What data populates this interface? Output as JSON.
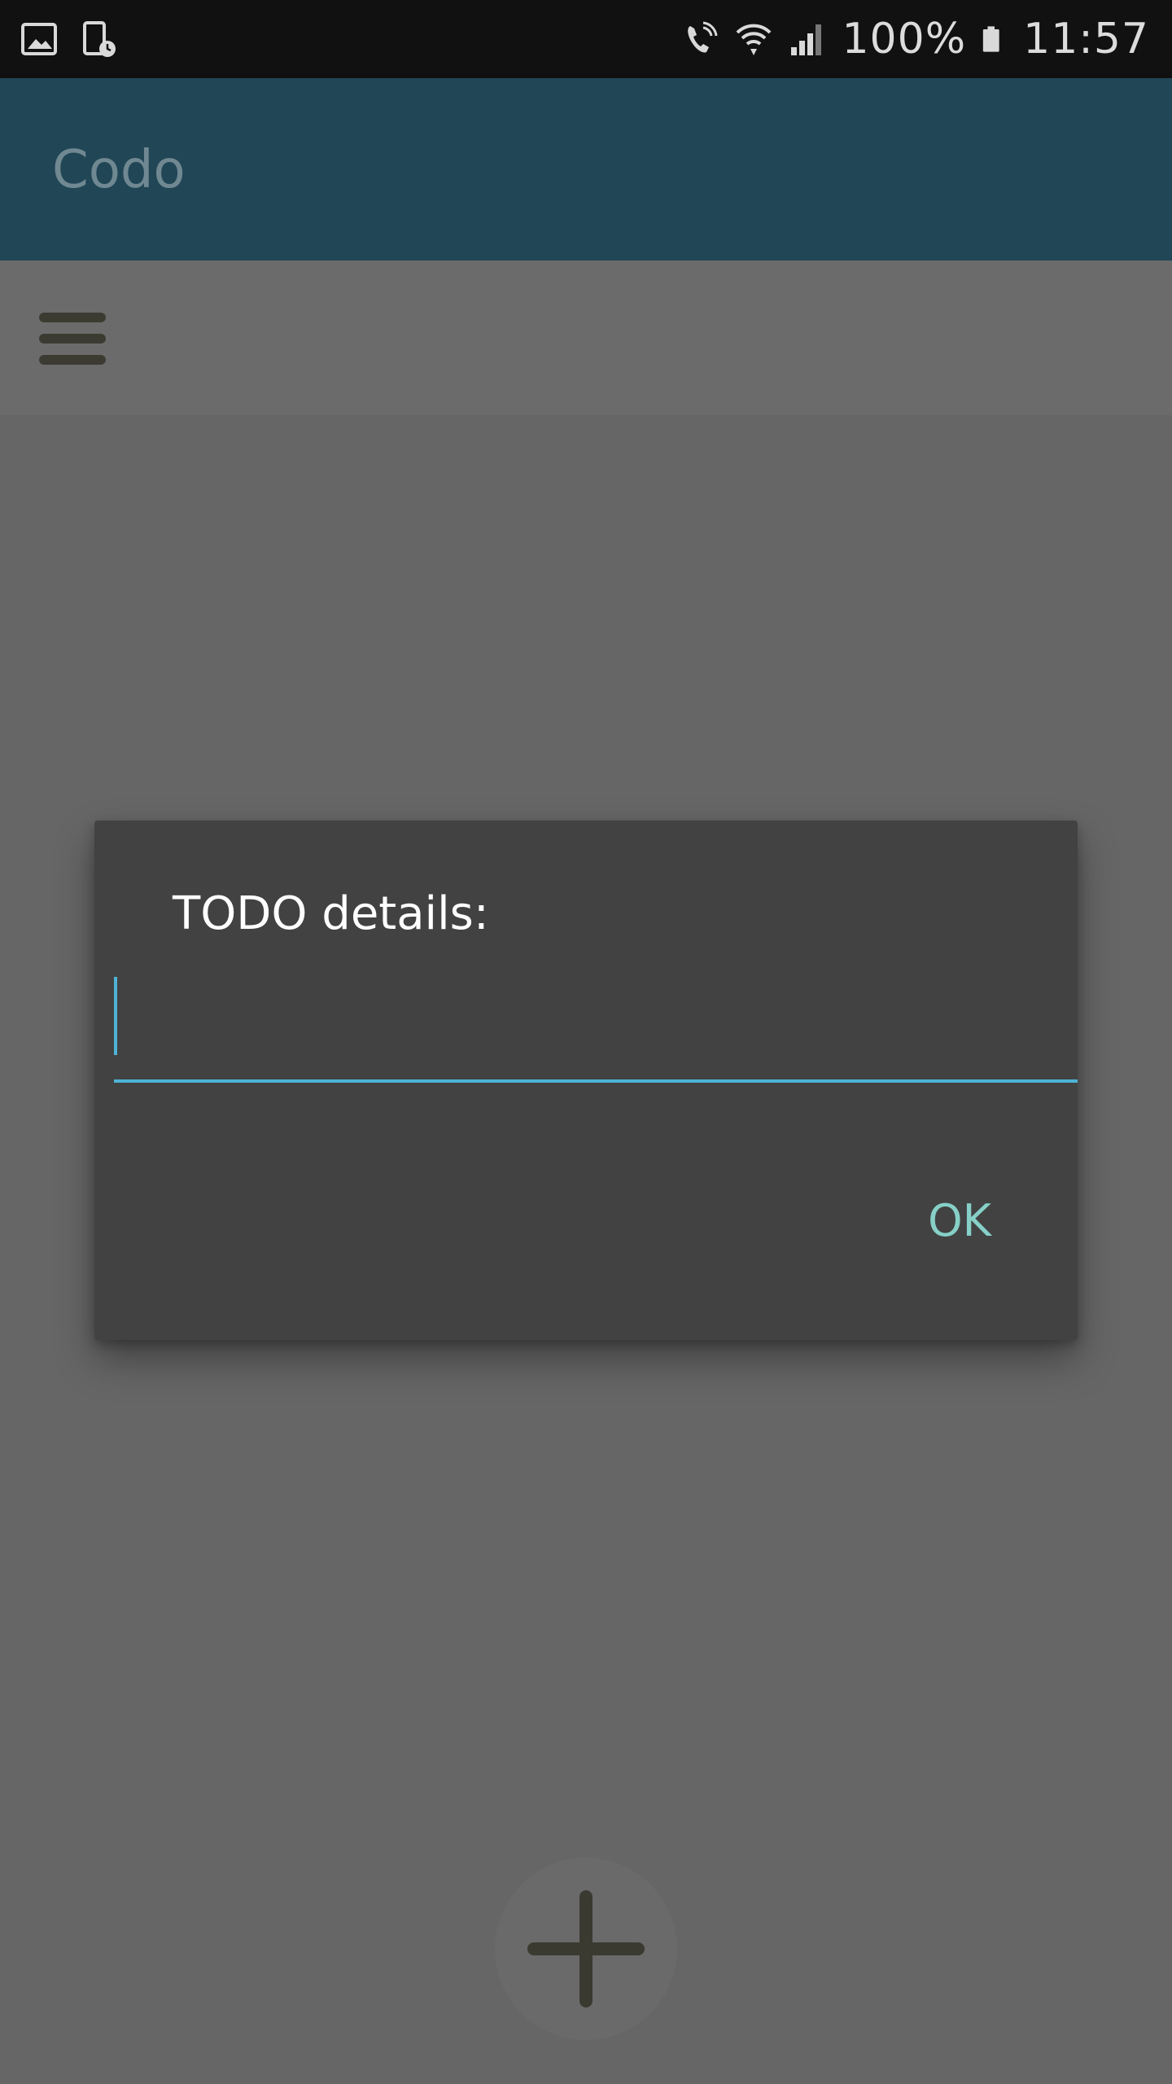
{
  "status_bar": {
    "battery": "100%",
    "time": "11:57",
    "icons_left": [
      "gallery-icon",
      "device-clock-icon"
    ],
    "icons_right": [
      "wifi-calling-icon",
      "wifi-icon",
      "signal-icon",
      "battery-icon"
    ]
  },
  "app_bar": {
    "title": "Codo"
  },
  "dialog": {
    "title": "TODO details:",
    "input_value": "",
    "ok_label": "OK",
    "accent_color": "#4fb3d6"
  },
  "colors": {
    "app_bar": "#214656",
    "dialog_bg": "#424242",
    "scrim_bg": "#666666",
    "ok_text": "#86d0c8"
  }
}
